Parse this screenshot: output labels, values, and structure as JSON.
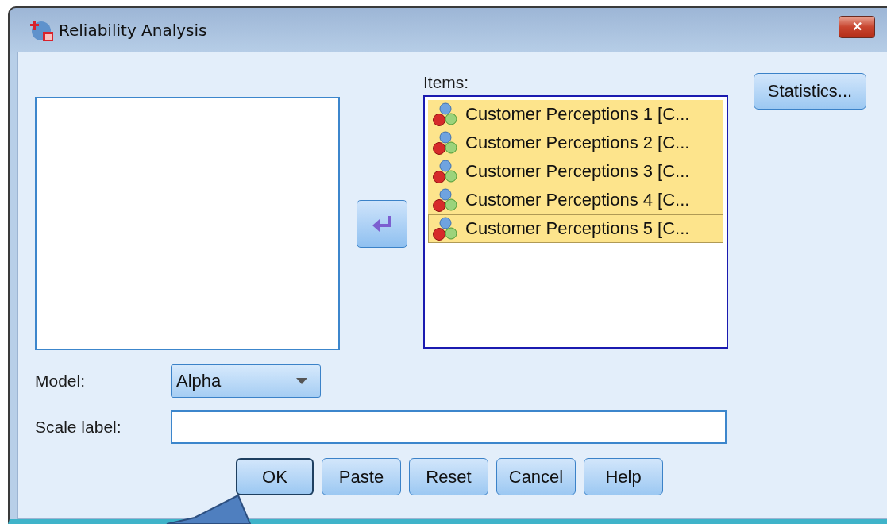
{
  "window": {
    "title": "Reliability Analysis",
    "close_label": "✕"
  },
  "items_label": "Items:",
  "items": [
    {
      "label": "Customer Perceptions 1 [C...",
      "selected": true,
      "focused": false
    },
    {
      "label": "Customer Perceptions 2 [C...",
      "selected": true,
      "focused": false
    },
    {
      "label": "Customer Perceptions 3 [C...",
      "selected": true,
      "focused": false
    },
    {
      "label": "Customer Perceptions 4 [C...",
      "selected": true,
      "focused": false
    },
    {
      "label": "Customer Perceptions 5 [C...",
      "selected": true,
      "focused": true
    }
  ],
  "statistics_button": "Statistics...",
  "model": {
    "label": "Model:",
    "value": "Alpha"
  },
  "scale_label": {
    "label": "Scale label:"
  },
  "buttons": [
    {
      "label": "OK",
      "default": true
    },
    {
      "label": "Paste",
      "default": false
    },
    {
      "label": "Reset",
      "default": false
    },
    {
      "label": "Cancel",
      "default": false
    },
    {
      "label": "Help",
      "default": false
    }
  ]
}
